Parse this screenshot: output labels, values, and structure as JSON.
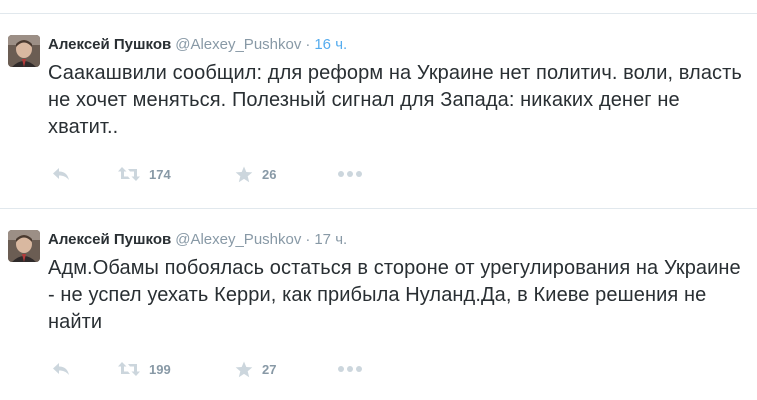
{
  "tweets": [
    {
      "author_name": "Алексей Пушков",
      "handle": "@Alexey_Pushkov",
      "separator": "·",
      "time": "16 ч.",
      "text": "Саакашвили сообщил: для реформ на Украине нет политич. воли, власть не хочет меняться. Полезный сигнал для Запада: никаких денег не хватит..",
      "retweets": "174",
      "favorites": "26",
      "time_color": "#55acee"
    },
    {
      "author_name": "Алексей Пушков",
      "handle": "@Alexey_Pushkov",
      "separator": "·",
      "time": "17 ч.",
      "text": "Адм.Обамы побоялась остаться в стороне от урегулирования на Украине - не успел уехать Керри, как прибыла Нуланд.Да, в Киеве решения не найти",
      "retweets": "199",
      "favorites": "27",
      "time_color": "#8899a6"
    }
  ],
  "icons": {
    "reply": "reply-icon",
    "retweet": "retweet-icon",
    "favorite": "star-icon",
    "more": "more-icon"
  },
  "colors": {
    "text": "#292f33",
    "muted": "#8899a6",
    "icon": "#ccd6dd",
    "divider": "#e1e8ed",
    "link": "#55acee"
  }
}
